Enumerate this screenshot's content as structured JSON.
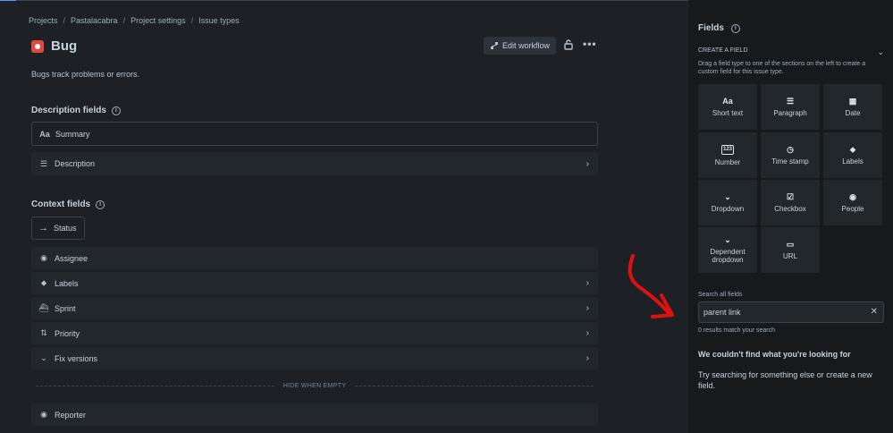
{
  "breadcrumb": [
    "Projects",
    "Pastalacabra",
    "Project settings",
    "Issue types"
  ],
  "breadcrumb_sep": "/",
  "issue_type": {
    "name": "Bug",
    "description": "Bugs track problems or errors."
  },
  "header_actions": {
    "edit_workflow": "Edit workflow"
  },
  "description_fields": {
    "title": "Description fields",
    "items": [
      {
        "label": "Summary",
        "icon": "text-aa-icon"
      },
      {
        "label": "Description",
        "icon": "lines-icon"
      }
    ]
  },
  "context_fields": {
    "title": "Context fields",
    "status": {
      "label": "Status",
      "icon": "arrow-right-icon"
    },
    "items": [
      {
        "label": "Assignee",
        "icon": "person-icon"
      },
      {
        "label": "Labels",
        "icon": "tag-icon"
      },
      {
        "label": "Sprint",
        "icon": "sprint-icon"
      },
      {
        "label": "Priority",
        "icon": "priority-icon"
      },
      {
        "label": "Fix versions",
        "icon": "chevron-circle-icon"
      }
    ],
    "hide_when_empty": "HIDE WHEN EMPTY",
    "hidden_items": [
      {
        "label": "Reporter",
        "icon": "person-icon"
      }
    ]
  },
  "panel": {
    "title": "Fields",
    "create_field_header": "CREATE A FIELD",
    "create_field_hint": "Drag a field type to one of the sections on the left to create a custom field for this issue type.",
    "field_types": [
      {
        "label": "Short text",
        "glyph": "Aa"
      },
      {
        "label": "Paragraph",
        "glyph": "☰"
      },
      {
        "label": "Date",
        "glyph": "▦"
      },
      {
        "label": "Number",
        "glyph": "123"
      },
      {
        "label": "Time stamp",
        "glyph": "◷"
      },
      {
        "label": "Labels",
        "glyph": "⬥"
      },
      {
        "label": "Dropdown",
        "glyph": "⌄"
      },
      {
        "label": "Checkbox",
        "glyph": "☑"
      },
      {
        "label": "People",
        "glyph": "◉"
      },
      {
        "label": "Dependent dropdown",
        "glyph": "⌄"
      },
      {
        "label": "URL",
        "glyph": "▭"
      }
    ],
    "search_label": "Search all fields",
    "search_value": "parent link",
    "results_text": "0 results match your search",
    "empty_title": "We couldn't find what you're looking for",
    "empty_body": "Try searching for something else or create a new field."
  },
  "colors": {
    "accent_red": "#e2483d",
    "annotation_arrow": "#e01010",
    "background": "#1d2125",
    "panel": "#161a1d"
  }
}
